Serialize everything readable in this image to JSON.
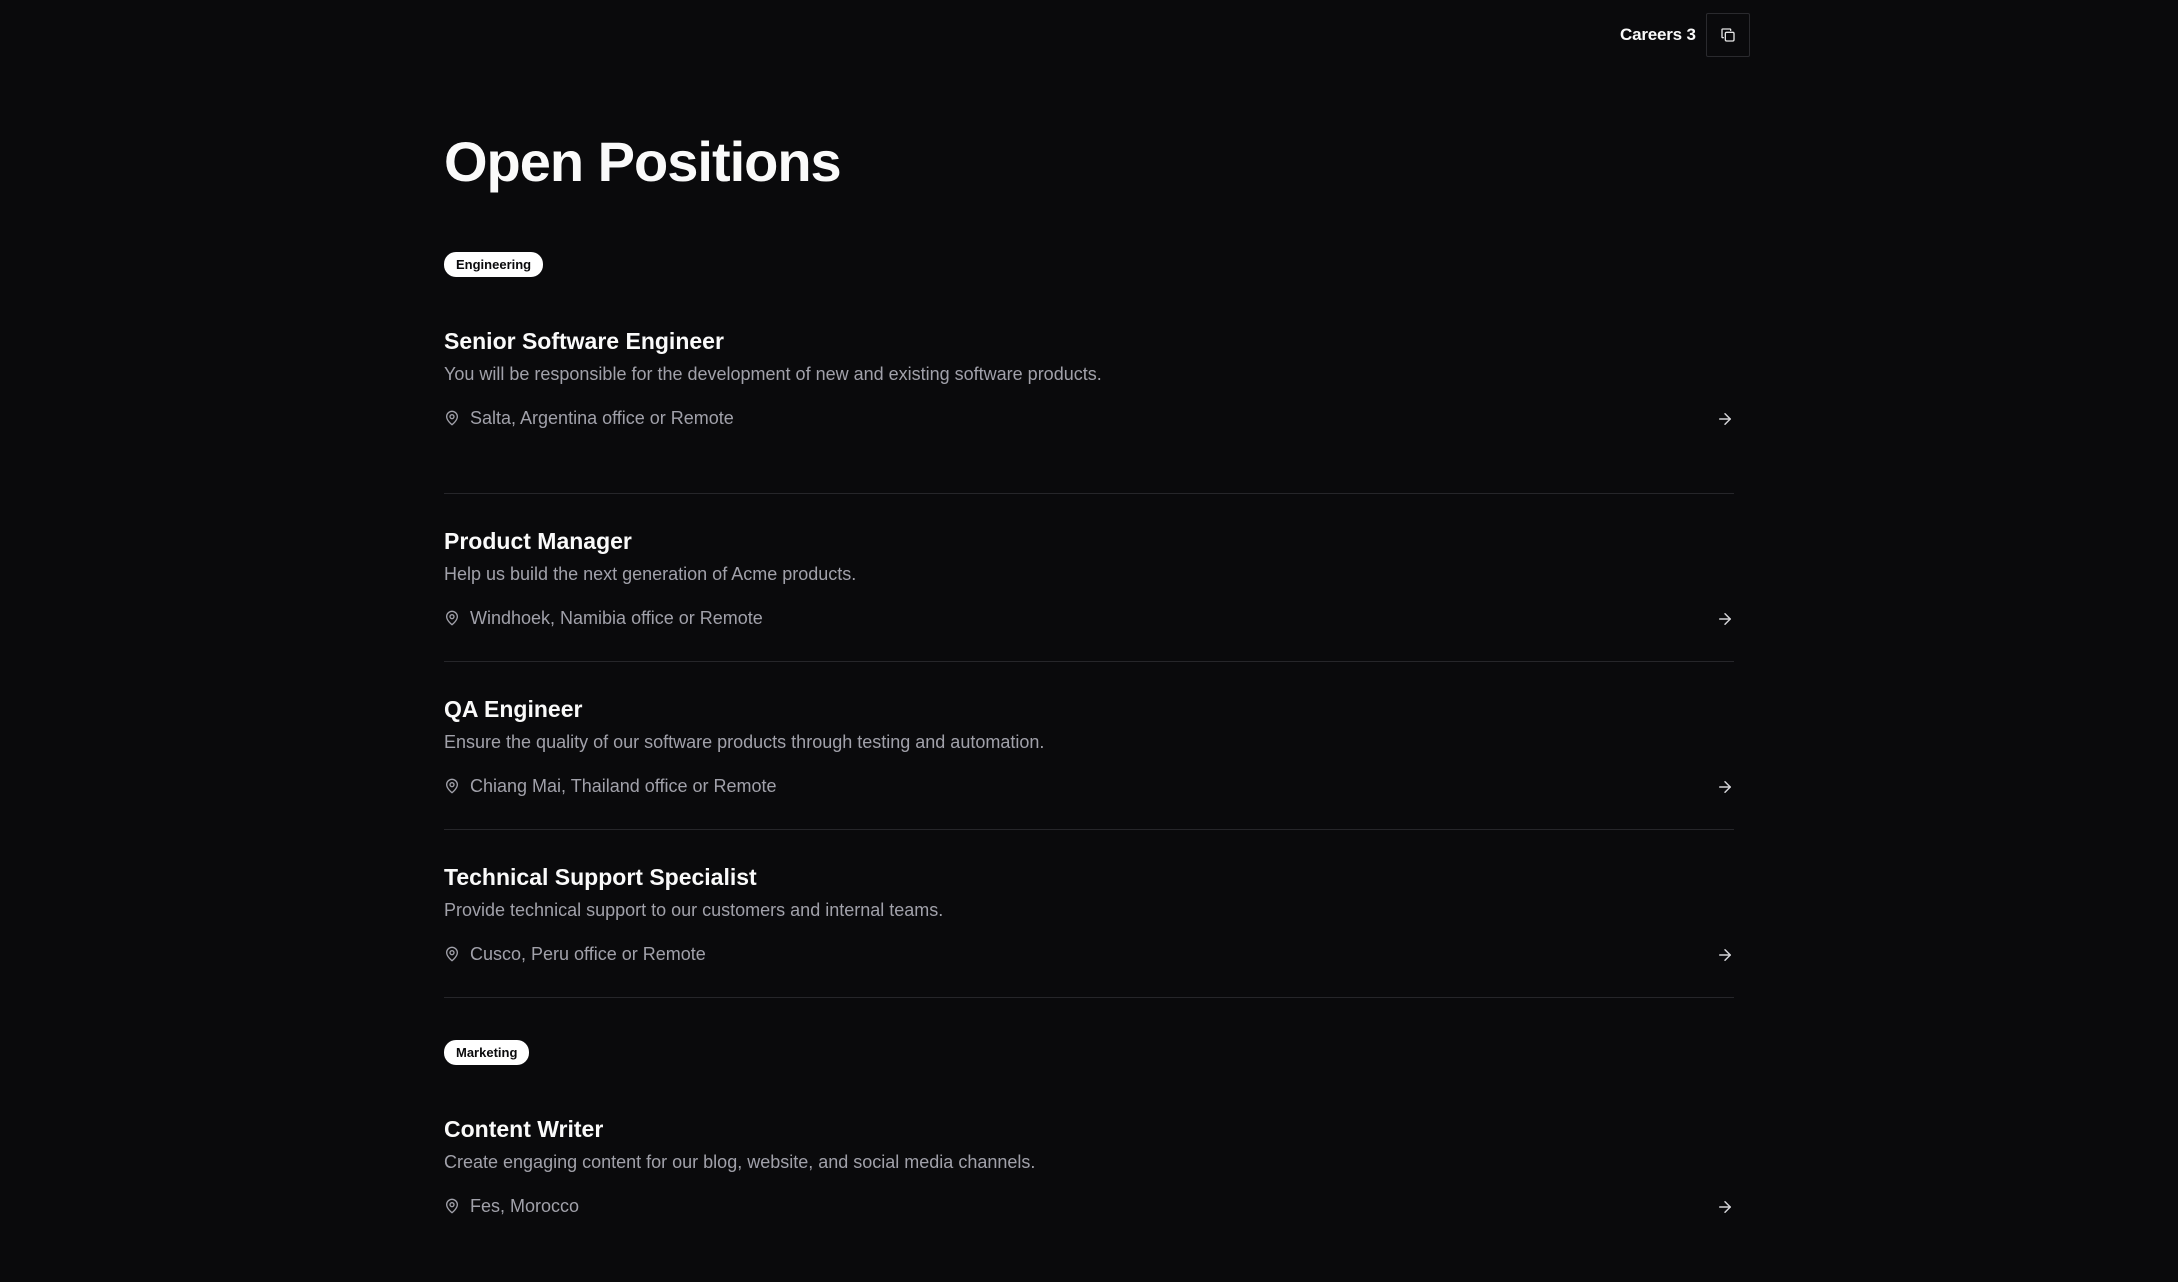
{
  "header": {
    "title": "Careers 3",
    "copy_icon": "copy-icon"
  },
  "page": {
    "title": "Open Positions"
  },
  "sections": [
    {
      "badge": "Engineering",
      "jobs": [
        {
          "title": "Senior Software Engineer",
          "description": "You will be responsible for the development of new and existing software products.",
          "location": "Salta, Argentina office or Remote"
        },
        {
          "title": "Product Manager",
          "description": "Help us build the next generation of Acme products.",
          "location": "Windhoek, Namibia office or Remote"
        },
        {
          "title": "QA Engineer",
          "description": "Ensure the quality of our software products through testing and automation.",
          "location": "Chiang Mai, Thailand office or Remote"
        },
        {
          "title": "Technical Support Specialist",
          "description": "Provide technical support to our customers and internal teams.",
          "location": "Cusco, Peru office or Remote"
        }
      ]
    },
    {
      "badge": "Marketing",
      "jobs": [
        {
          "title": "Content Writer",
          "description": "Create engaging content for our blog, website, and social media channels.",
          "location": "Fes, Morocco"
        }
      ]
    }
  ],
  "icons": {
    "location": "map-pin-icon",
    "arrow": "arrow-right-icon"
  },
  "colors": {
    "background": "#0a0a0c",
    "text": "#fafafa",
    "muted": "#a1a1aa",
    "divider": "#26262a"
  }
}
